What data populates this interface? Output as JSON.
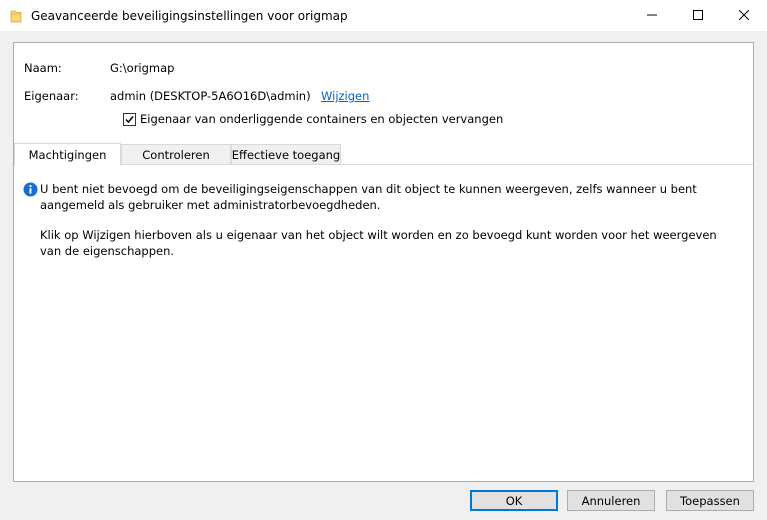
{
  "window": {
    "title": "Geavanceerde beveiligingsinstellingen voor origmap"
  },
  "info": {
    "name_label": "Naam:",
    "name_value": "G:\\origmap",
    "owner_label": "Eigenaar:",
    "owner_value": "admin (DESKTOP-5A6O16D\\admin)",
    "owner_change_link": "Wijzigen",
    "replace_owner_checkbox": {
      "label": "Eigenaar van onderliggende containers en objecten vervangen",
      "checked": true
    }
  },
  "tabs": [
    {
      "label": "Machtigingen",
      "active": true
    },
    {
      "label": "Controleren",
      "active": false
    },
    {
      "label": "Effectieve toegang",
      "active": false
    }
  ],
  "message": {
    "line1": "U bent niet bevoegd om de beveiligingseigenschappen van dit object te kunnen weergeven, zelfs wanneer u bent aangemeld als gebruiker met administratorbevoegdheden.",
    "line2": "Klik op Wijzigen hierboven als u eigenaar van het object wilt worden en zo bevoegd kunt worden voor het weergeven van de eigenschappen."
  },
  "buttons": {
    "ok": "OK",
    "cancel": "Annuleren",
    "apply": "Toepassen"
  },
  "colors": {
    "accent": "#0078d7",
    "link": "#0066cc",
    "folder": "#f8d775"
  }
}
